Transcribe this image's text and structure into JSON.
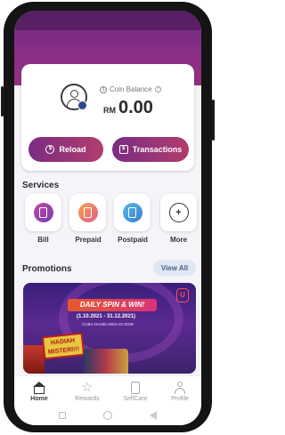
{
  "balance": {
    "label": "Coin Balance",
    "currency": "RM",
    "amount": "0.00"
  },
  "actions": {
    "reload_label": "Reload",
    "transactions_label": "Transactions"
  },
  "services": {
    "title": "Services",
    "items": [
      {
        "label": "Bill",
        "icon": "bill-icon"
      },
      {
        "label": "Prepaid",
        "icon": "prepaid-sim-icon"
      },
      {
        "label": "Postpaid",
        "icon": "postpaid-phone-icon"
      },
      {
        "label": "More",
        "icon": "plus-icon"
      }
    ]
  },
  "promotions": {
    "title": "Promotions",
    "view_all_label": "View All",
    "banner": {
      "headline": "DAILY SPIN & WIN!",
      "dates": "(1.10.2021 - 31.12.2021)",
      "subtitle": "CUBA NASIB ANDA DI SINI!!",
      "badge": "HADIAH MISTERI!!!",
      "logo": "U"
    }
  },
  "tabbar": {
    "items": [
      {
        "label": "Home",
        "active": true
      },
      {
        "label": "Rewards",
        "active": false
      },
      {
        "label": "SelfCare",
        "active": false
      },
      {
        "label": "Profile",
        "active": false
      }
    ]
  },
  "colors": {
    "brand": "#7a2c82",
    "brand_gradient_end": "#b23d6e",
    "view_all_bg": "#dfe7f3"
  }
}
